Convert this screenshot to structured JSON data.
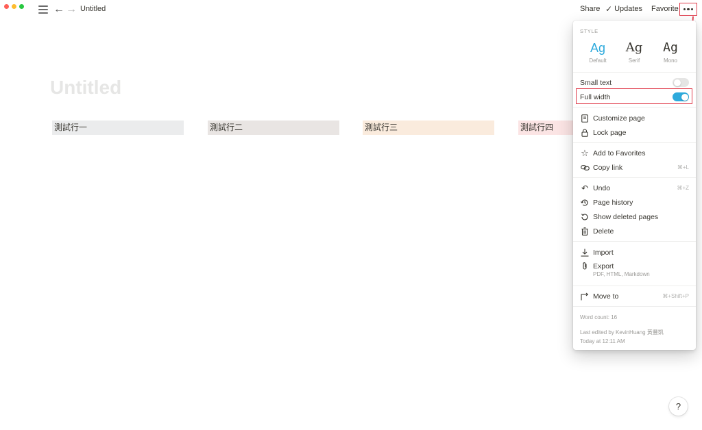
{
  "window": {
    "title": "Untitled"
  },
  "topbar": {
    "share": "Share",
    "updates": "Updates",
    "favorite": "Favorite"
  },
  "page": {
    "title": "Untitled",
    "columns": [
      "測試行一",
      "測試行二",
      "測試行三",
      "測試行四"
    ]
  },
  "help": {
    "label": "?"
  },
  "menu": {
    "style_label": "STYLE",
    "fonts": [
      {
        "glyph": "Ag",
        "label": "Default",
        "selected": true
      },
      {
        "glyph": "Ag",
        "label": "Serif",
        "selected": false
      },
      {
        "glyph": "Ag",
        "label": "Mono",
        "selected": false
      }
    ],
    "small_text": {
      "label": "Small text",
      "on": false
    },
    "full_width": {
      "label": "Full width",
      "on": true
    },
    "customize_page": "Customize page",
    "lock_page": "Lock page",
    "add_favorites": "Add to Favorites",
    "copy_link": {
      "label": "Copy link",
      "shortcut": "⌘+L"
    },
    "undo": {
      "label": "Undo",
      "shortcut": "⌘+Z"
    },
    "page_history": "Page history",
    "show_deleted": "Show deleted pages",
    "delete": "Delete",
    "import": "Import",
    "export": {
      "label": "Export",
      "sub": "PDF, HTML, Markdown"
    },
    "move_to": {
      "label": "Move to",
      "shortcut": "⌘+Shift+P"
    },
    "word_count": "Word count: 16",
    "last_edited": "Last edited by KevinHuang 黃豐凱",
    "edited_time": "Today at 12:11 AM"
  },
  "colors": {
    "accent": "#2eaadc",
    "annotation": "#e03c4c"
  }
}
